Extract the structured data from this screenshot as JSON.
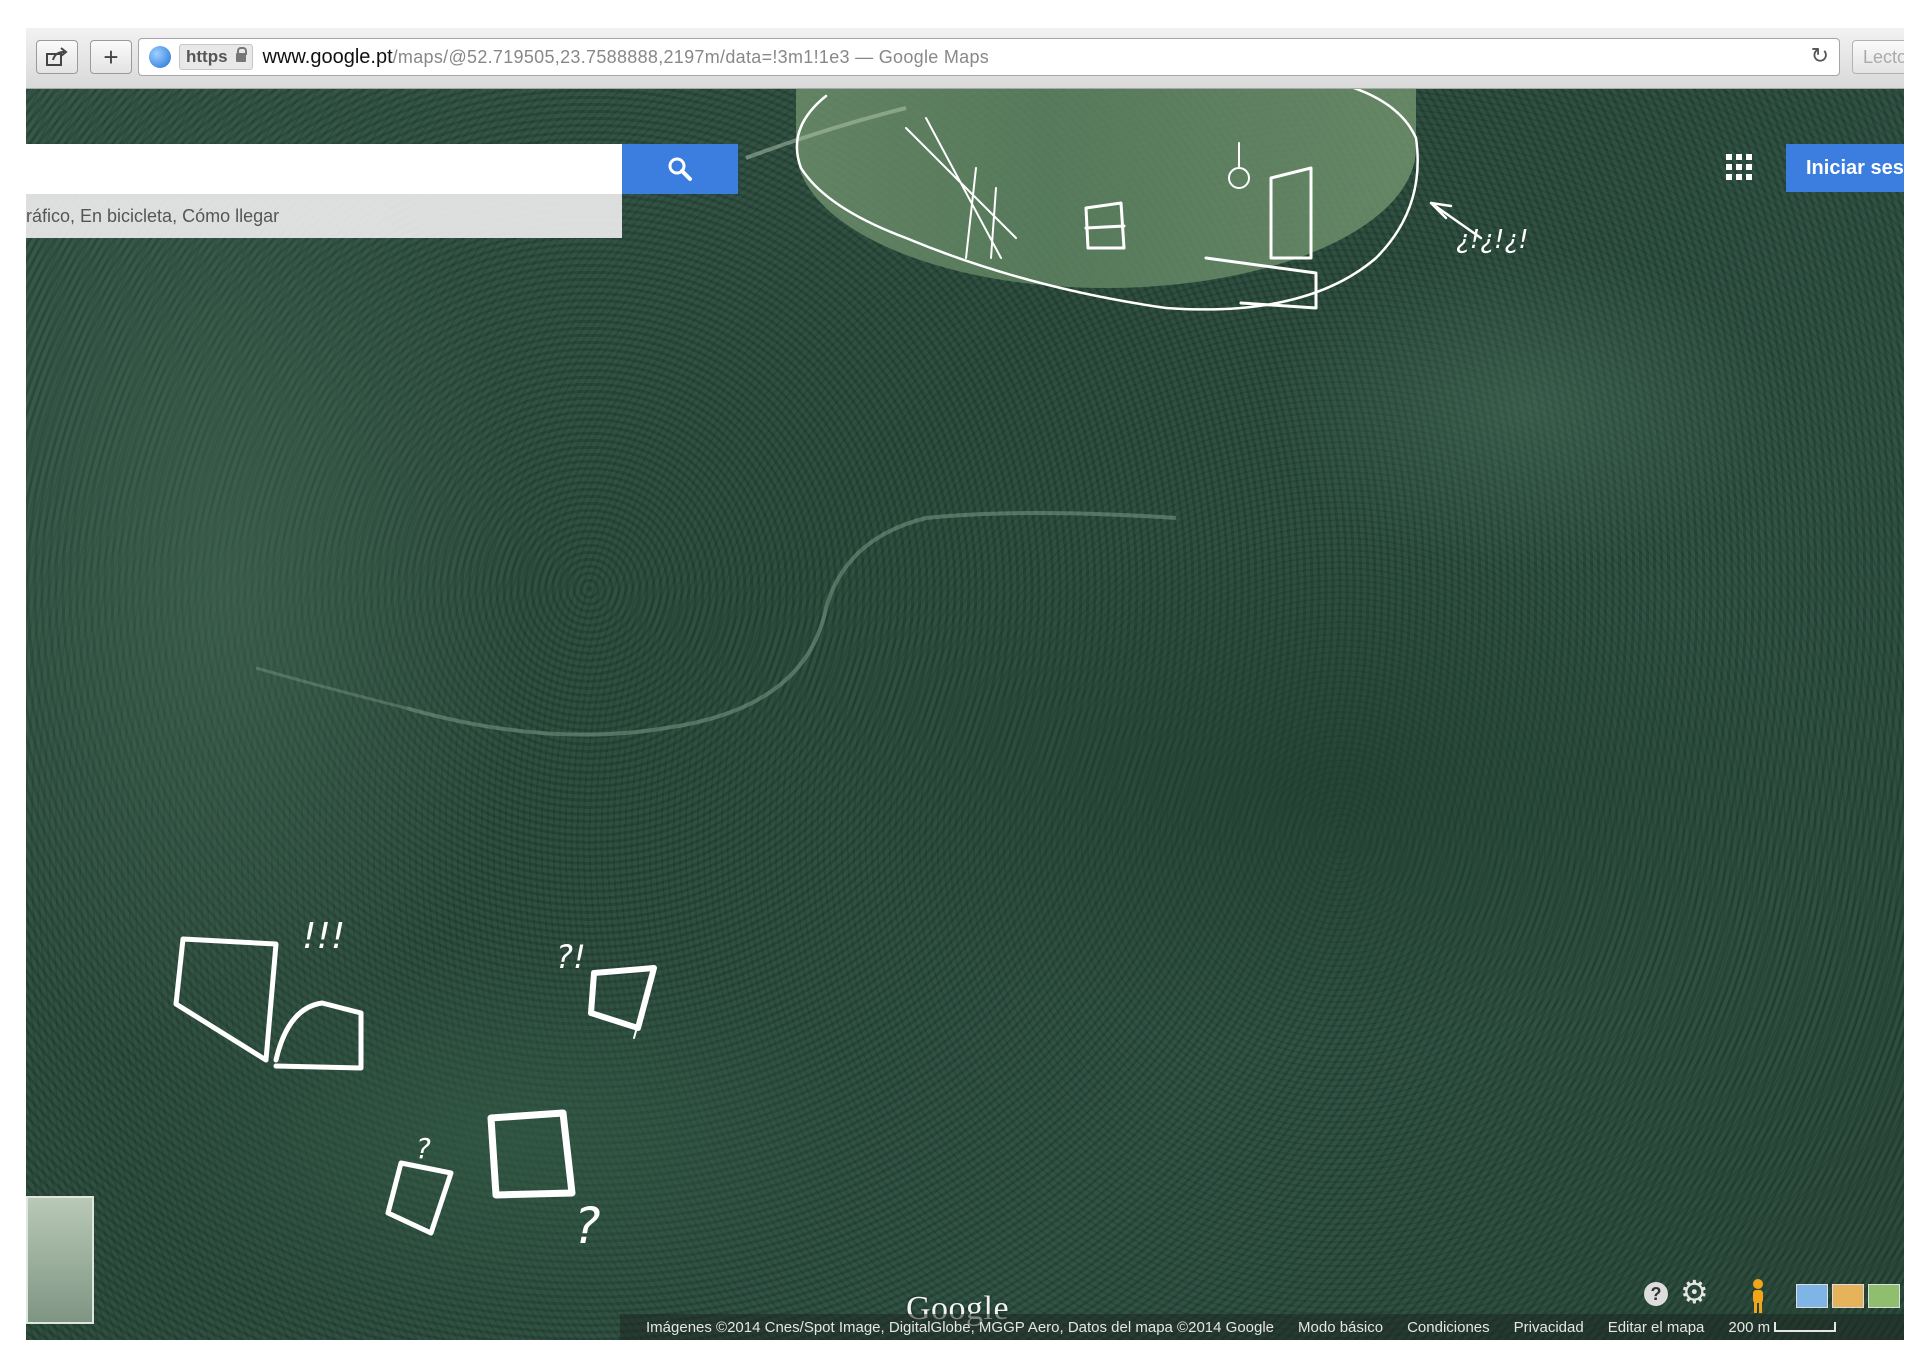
{
  "browser": {
    "scheme_badge": "https",
    "url_domain": "www.google.pt",
    "url_path": "/maps/@52.719505,23.7588888,2197m/data=!3m1!1e3 — Google Maps",
    "reader_label": "Lecto"
  },
  "maps_ui": {
    "search_input_value": "",
    "search_hint": "ráfico, En bicicleta, Cómo llegar",
    "signin_label": "Iniciar ses",
    "logo_text": "Google",
    "help_label": "?",
    "footer": {
      "attribution": "Imágenes ©2014 Cnes/Spot Image, DigitalGlobe, MGGP Aero, Datos del mapa ©2014 Google",
      "basic_mode": "Modo básico",
      "terms": "Condiciones",
      "privacy": "Privacidad",
      "edit_map": "Editar el mapa",
      "scale": "200 m"
    },
    "layer_colors": [
      "#7fb4e6",
      "#e6b35a",
      "#8fbf6e"
    ]
  },
  "handwritten_notes": {
    "top_right": "¿!¿!¿!",
    "triple_exclaim": "!!!",
    "question_exclaim": "?!",
    "question_small": "?",
    "question_big": "?"
  },
  "icons": {
    "share": "share-icon",
    "new_tab": "plus-icon",
    "globe": "globe-icon",
    "lock": "lock-icon",
    "reload": "reload-icon",
    "search": "search-icon",
    "apps": "apps-grid-icon",
    "help": "help-icon",
    "settings": "gear-icon",
    "street_view": "pegman-icon"
  }
}
